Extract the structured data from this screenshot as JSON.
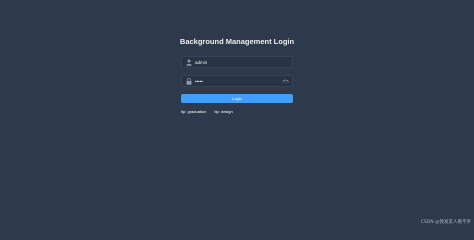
{
  "page": {
    "title": "Background Management Login",
    "background_color": "#2d3a4b",
    "accent_color": "#409eff"
  },
  "username": {
    "value": "admin",
    "icon": "user-icon"
  },
  "password": {
    "value": "•••••",
    "icon": "lock-icon",
    "toggle_icon": "eye-icon"
  },
  "login_button": {
    "label": "Login"
  },
  "tips": [
    {
      "label": "tip:",
      "value": "graduation"
    },
    {
      "label": "tip:",
      "value": "design"
    }
  ],
  "watermark": {
    "text": "CSDN @我发友人看不罗"
  }
}
